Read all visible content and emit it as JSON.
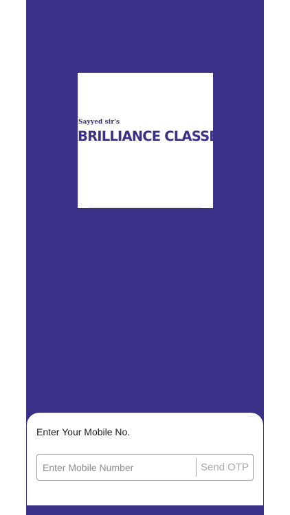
{
  "colors": {
    "brand": "#3a3088",
    "sheet_background": "#ffffff",
    "label_text": "#1c1c1c",
    "placeholder_text": "#8e8e8e",
    "disabled_button_text": "#a9a9a9",
    "input_border": "#9a9a9a"
  },
  "logo": {
    "subtitle": "Sayyed sir's",
    "title": "BRILLIANCE CLASSES"
  },
  "login": {
    "label": "Enter Your Mobile No.",
    "mobile_input": {
      "value": "",
      "placeholder": "Enter Mobile Number"
    },
    "send_otp_label": "Send OTP"
  }
}
